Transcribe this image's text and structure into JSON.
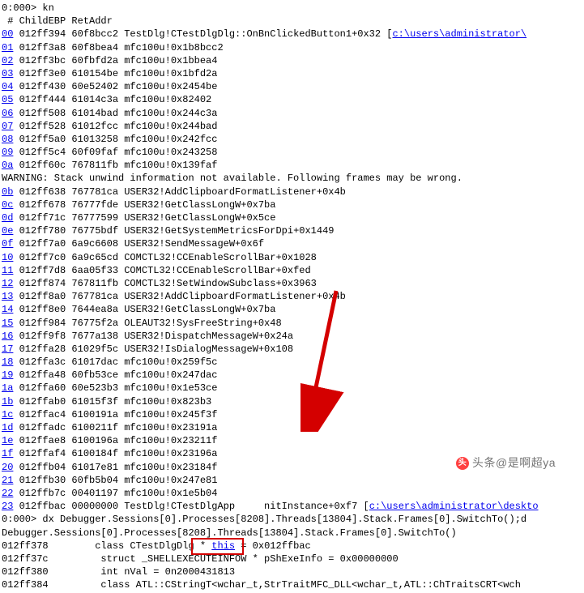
{
  "prompt1": "0:000> kn",
  "header": " # ChildEBP RetAddr  ",
  "frames": [
    {
      "i": "00",
      "addr": "012ff394 60f8bcc2",
      "sym": "TestDlg!CTestDlgDlg::OnBnClickedButton1+0x32",
      "link": "c:\\users\\administrator\\"
    },
    {
      "i": "01",
      "addr": "012ff3a8 60f8bea4",
      "sym": "mfc100u!0x1b8bcc2"
    },
    {
      "i": "02",
      "addr": "012ff3bc 60fbfd2a",
      "sym": "mfc100u!0x1bbea4"
    },
    {
      "i": "03",
      "addr": "012ff3e0 610154be",
      "sym": "mfc100u!0x1bfd2a"
    },
    {
      "i": "04",
      "addr": "012ff430 60e52402",
      "sym": "mfc100u!0x2454be"
    },
    {
      "i": "05",
      "addr": "012ff444 61014c3a",
      "sym": "mfc100u!0x82402"
    },
    {
      "i": "06",
      "addr": "012ff508 61014bad",
      "sym": "mfc100u!0x244c3a"
    },
    {
      "i": "07",
      "addr": "012ff528 61012fcc",
      "sym": "mfc100u!0x244bad"
    },
    {
      "i": "08",
      "addr": "012ff5a0 61013258",
      "sym": "mfc100u!0x242fcc"
    },
    {
      "i": "09",
      "addr": "012ff5c4 60f09faf",
      "sym": "mfc100u!0x243258"
    },
    {
      "i": "0a",
      "addr": "012ff60c 767811fb",
      "sym": "mfc100u!0x139faf"
    }
  ],
  "warn": "WARNING: Stack unwind information not available. Following frames may be wrong.",
  "frames2": [
    {
      "i": "0b",
      "addr": "012ff638 767781ca",
      "sym": "USER32!AddClipboardFormatListener+0x4b"
    },
    {
      "i": "0c",
      "addr": "012ff678 76777fde",
      "sym": "USER32!GetClassLongW+0x7ba"
    },
    {
      "i": "0d",
      "addr": "012ff71c 76777599",
      "sym": "USER32!GetClassLongW+0x5ce"
    },
    {
      "i": "0e",
      "addr": "012ff780 76775bdf",
      "sym": "USER32!GetSystemMetricsForDpi+0x1449"
    },
    {
      "i": "0f",
      "addr": "012ff7a0 6a9c6608",
      "sym": "USER32!SendMessageW+0x6f"
    },
    {
      "i": "10",
      "addr": "012ff7c0 6a9c65cd",
      "sym": "COMCTL32!CCEnableScrollBar+0x1028"
    },
    {
      "i": "11",
      "addr": "012ff7d8 6aa05f33",
      "sym": "COMCTL32!CCEnableScrollBar+0xfed"
    },
    {
      "i": "12",
      "addr": "012ff874 767811fb",
      "sym": "COMCTL32!SetWindowSubclass+0x3963"
    },
    {
      "i": "13",
      "addr": "012ff8a0 767781ca",
      "sym": "USER32!AddClipboardFormatListener+0x4b"
    },
    {
      "i": "14",
      "addr": "012ff8e0 7644ea8a",
      "sym": "USER32!GetClassLongW+0x7ba"
    },
    {
      "i": "15",
      "addr": "012ff984 76775f2a",
      "sym": "OLEAUT32!SysFreeString+0x48"
    },
    {
      "i": "16",
      "addr": "012ff9f8 7677a138",
      "sym": "USER32!DispatchMessageW+0x24a"
    },
    {
      "i": "17",
      "addr": "012ffa28 61029f5c",
      "sym": "USER32!IsDialogMessageW+0x108"
    },
    {
      "i": "18",
      "addr": "012ffa3c 61017dac",
      "sym": "mfc100u!0x259f5c"
    },
    {
      "i": "19",
      "addr": "012ffa48 60fb53ce",
      "sym": "mfc100u!0x247dac"
    },
    {
      "i": "1a",
      "addr": "012ffa60 60e523b3",
      "sym": "mfc100u!0x1e53ce"
    },
    {
      "i": "1b",
      "addr": "012ffab0 61015f3f",
      "sym": "mfc100u!0x823b3"
    },
    {
      "i": "1c",
      "addr": "012ffac4 6100191a",
      "sym": "mfc100u!0x245f3f"
    },
    {
      "i": "1d",
      "addr": "012ffadc 6100211f",
      "sym": "mfc100u!0x23191a"
    },
    {
      "i": "1e",
      "addr": "012ffae8 6100196a",
      "sym": "mfc100u!0x23211f"
    },
    {
      "i": "1f",
      "addr": "012ffaf4 6100184f",
      "sym": "mfc100u!0x23196a"
    },
    {
      "i": "20",
      "addr": "012ffb04 61017e81",
      "sym": "mfc100u!0x23184f"
    },
    {
      "i": "21",
      "addr": "012ffb30 60fb5b04",
      "sym": "mfc100u!0x247e81"
    },
    {
      "i": "22",
      "addr": "012ffb7c 00401197",
      "sym": "mfc100u!0x1e5b04"
    },
    {
      "i": "23",
      "addr": "012ffbac 00000000",
      "sym": "TestDlg!CTestDlgApp",
      "tail": "nitInstance+0xf7",
      "link": "c:\\users\\administrator\\deskto"
    }
  ],
  "prompt2": "0:000> dx Debugger.Sessions[0].Processes[8208].Threads[13804].Stack.Frames[0].SwitchTo();d",
  "dx_line": "Debugger.Sessions[0].Processes[8208].Threads[13804].Stack.Frames[0].SwitchTo()",
  "locals": {
    "a": "012ff378",
    "a_text_left": "        class CTestDlgDlg",
    "this_kw": " * this ",
    "a_text_right": "= 0x012ffbac",
    "b": "012ff37c         struct _SHELLEXECUTEINFOW * pShExeInfo = 0x00000000",
    "c": "012ff380         int nVal = 0n2000431813",
    "d": "012ff384         class ATL::CStringT<wchar_t,StrTraitMFC_DLL<wchar_t,ATL::ChTraitsCRT<wch"
  },
  "wm": "头条@是啊超ya"
}
